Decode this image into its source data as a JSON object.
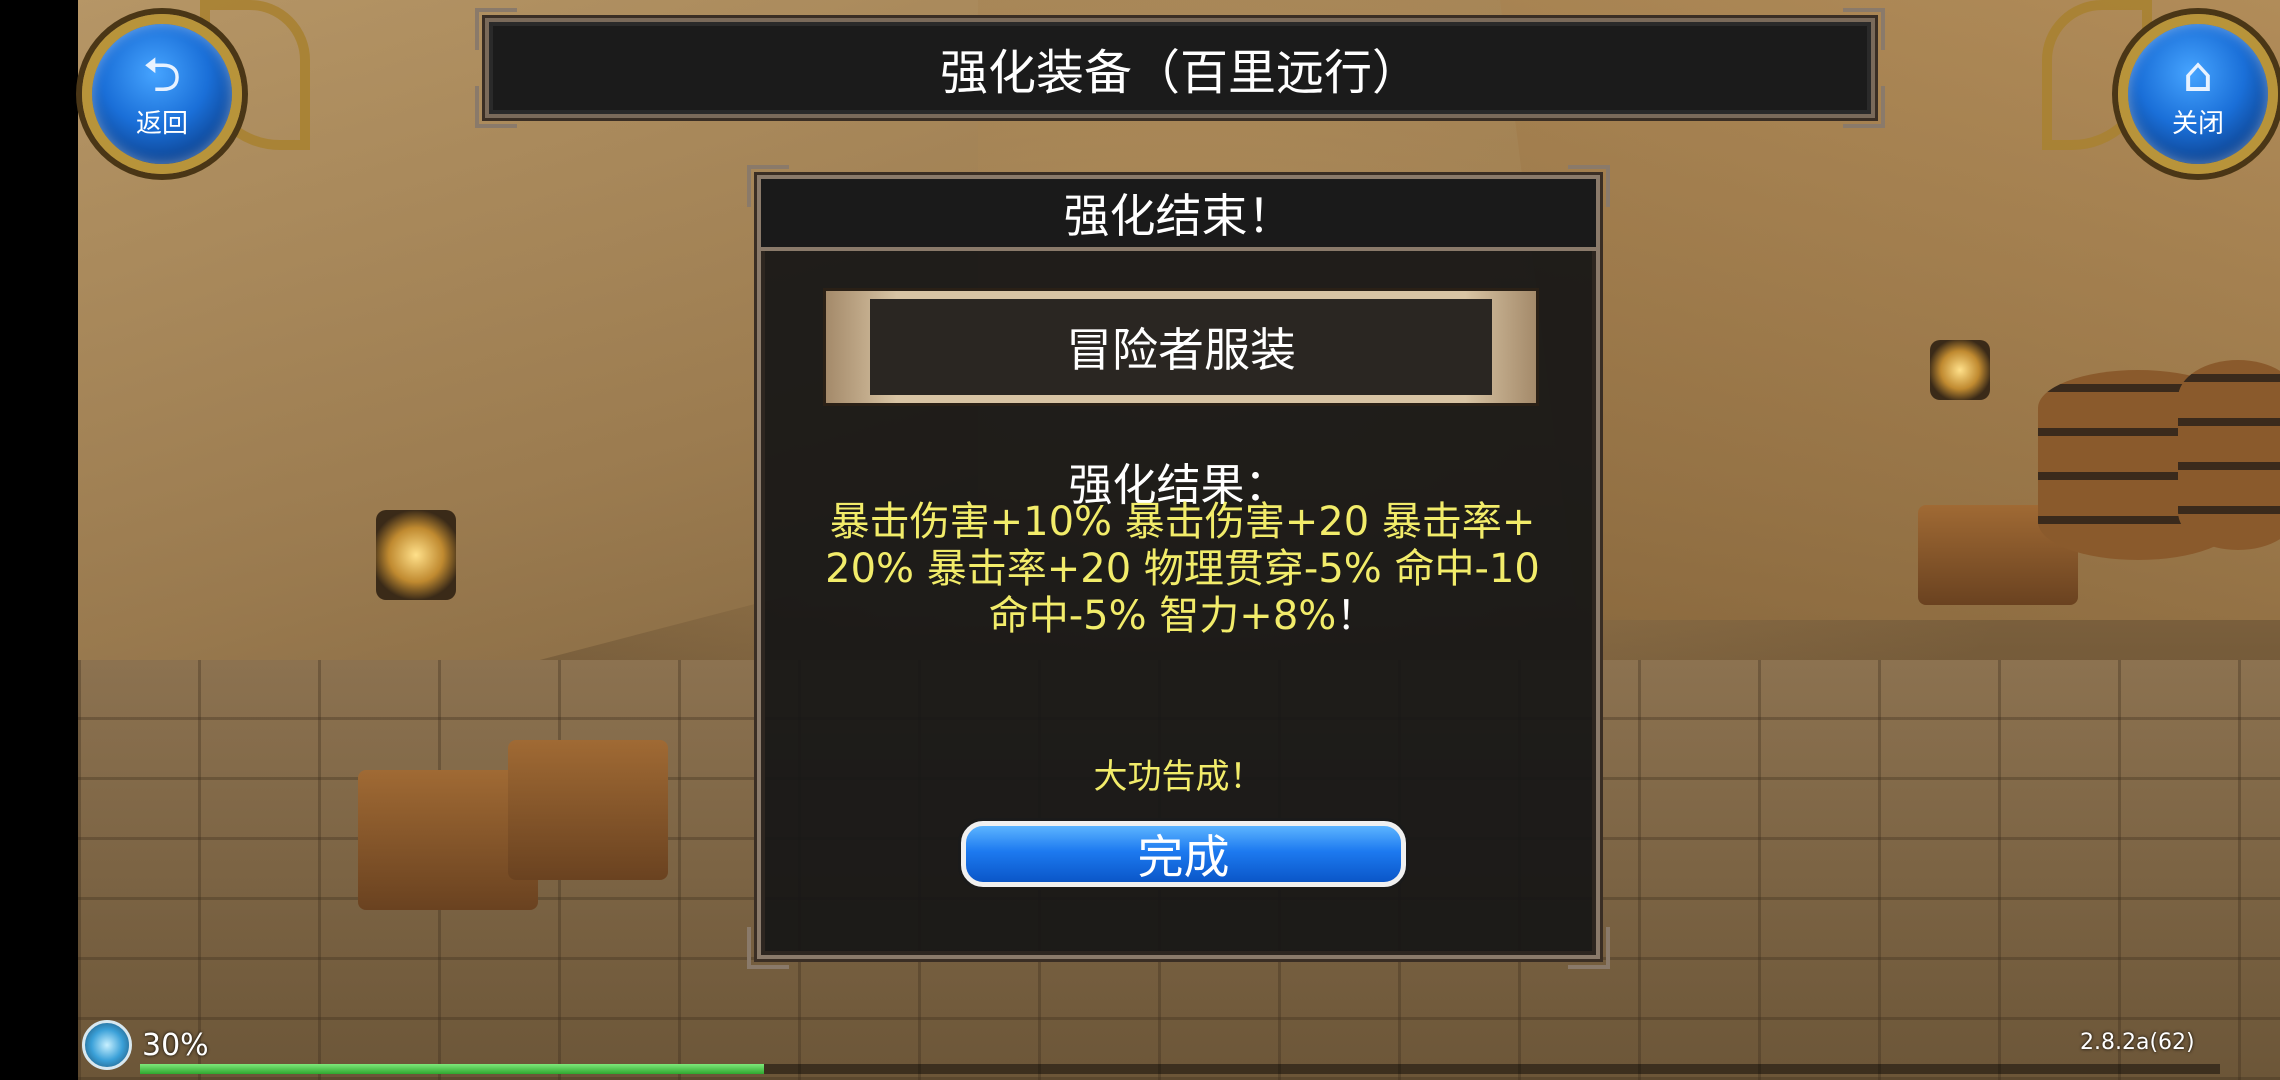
{
  "header": {
    "title": "强化装备（百里远行）"
  },
  "nav": {
    "back_label": "返回",
    "close_label": "关闭"
  },
  "dialog": {
    "title": "强化结束！",
    "item_name": "冒险者服装",
    "result_title": "强化结果：",
    "result_lines": [
      "暴击伤害+10% 暴击伤害+20 暴击率+",
      "20% 暴击率+20 物理贯穿-5% 命中-10",
      "命中-5% 智力+8%"
    ],
    "result_end": "！",
    "success_text": "大功告成！",
    "done_label": "完成"
  },
  "status": {
    "percent_label": "30%",
    "progress": 0.3,
    "version": "2.8.2a(62)"
  },
  "colors": {
    "dialog_bg": "#161616",
    "highlight_text": "#f2ec6a",
    "button_blue": "#1d7af0",
    "progress_green": "#2fa82f"
  }
}
